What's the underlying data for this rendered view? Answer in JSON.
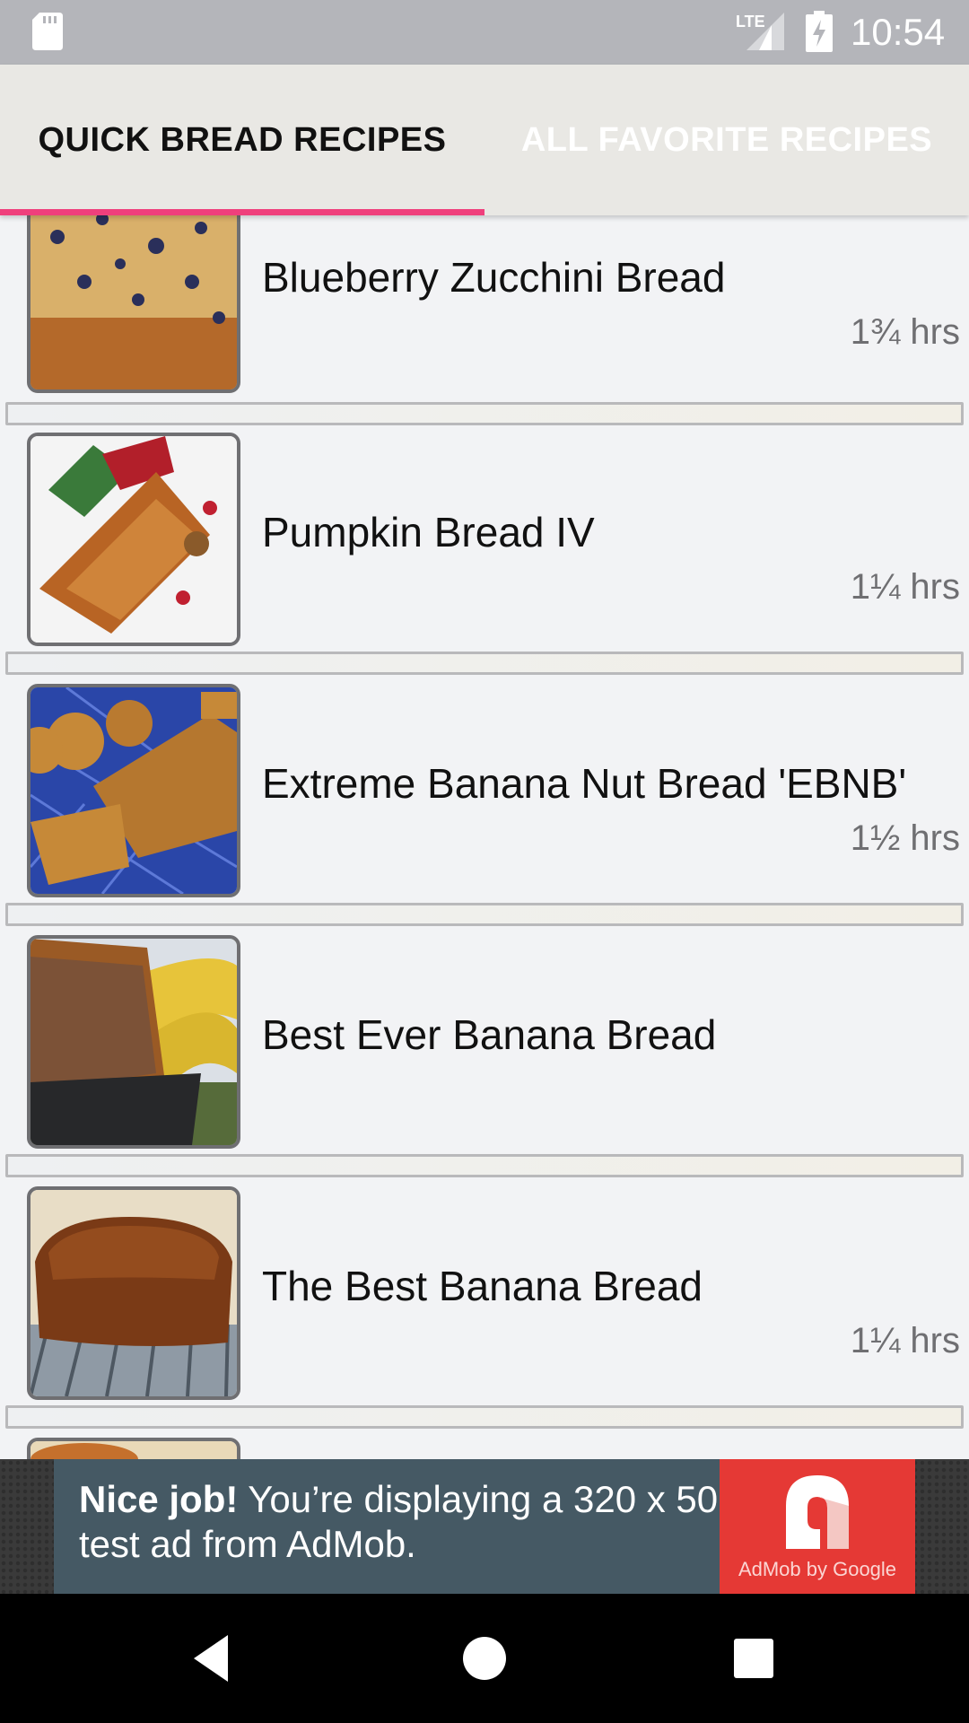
{
  "status_bar": {
    "time": "10:54",
    "network": "LTE",
    "icons": [
      "sd-card-icon",
      "lte-signal-icon",
      "battery-charging-icon"
    ]
  },
  "tabs": [
    {
      "label": "QUICK BREAD RECIPES",
      "selected": true
    },
    {
      "label": "ALL FAVORITE RECIPES",
      "selected": false
    }
  ],
  "colors": {
    "accent": "#ef3f7c",
    "tab_bar": "#e9e8e4",
    "list_bg": "#f2f3f5",
    "ad_banner": "#455964",
    "ad_logo": "#e53935"
  },
  "recipes": [
    {
      "title": "Blueberry Zucchini Bread",
      "time": "1¾ hrs"
    },
    {
      "title": "Pumpkin Bread IV",
      "time": "1¼ hrs"
    },
    {
      "title": "Extreme Banana Nut Bread 'EBNB'",
      "time": "1½ hrs"
    },
    {
      "title": "Best Ever Banana Bread",
      "time": ""
    },
    {
      "title": "The Best Banana Bread",
      "time": "1¼ hrs"
    }
  ],
  "ad": {
    "bold": "Nice job!",
    "text": " You’re displaying a 320 x 50 test ad from AdMob.",
    "logo_text": "AdMob by Google"
  },
  "nav": {
    "buttons": [
      "back-icon",
      "home-icon",
      "recents-icon"
    ]
  }
}
